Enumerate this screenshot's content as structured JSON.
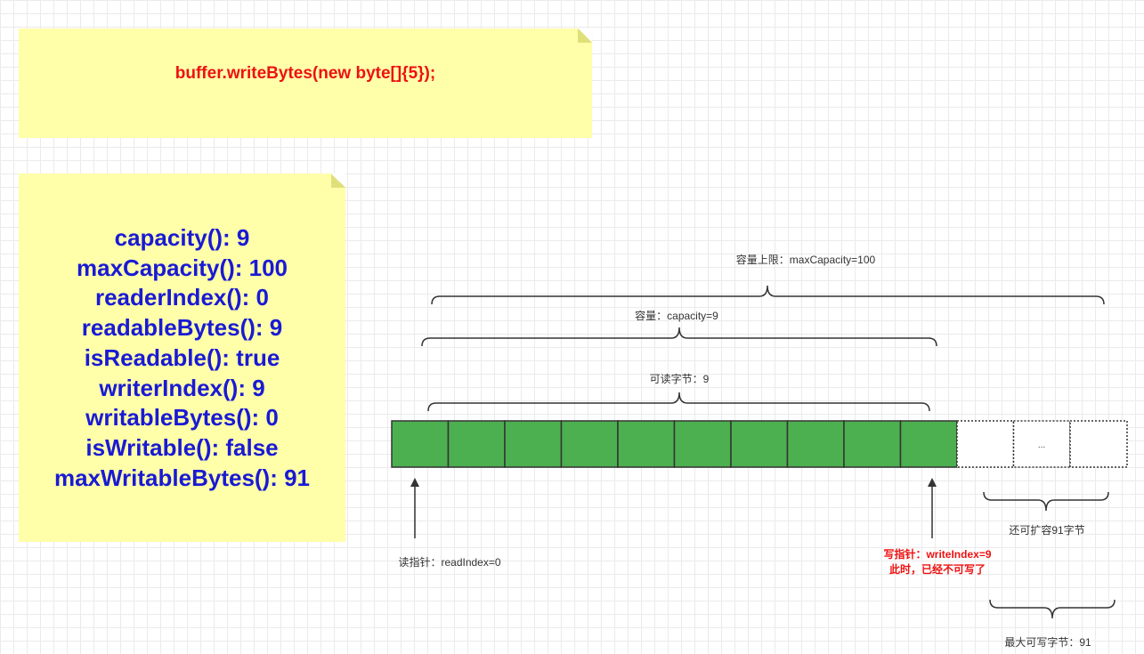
{
  "code_note": {
    "text": "buffer.writeBytes(new byte[]{5});"
  },
  "status_note": {
    "lines": [
      "capacity(): 9",
      "maxCapacity(): 100",
      "readerIndex(): 0",
      "readableBytes(): 9",
      "isReadable(): true",
      "writerIndex(): 9",
      "writableBytes(): 0",
      "isWritable(): false",
      "maxWritableBytes(): 91"
    ]
  },
  "diagram": {
    "brace_max_capacity": "容量上限：maxCapacity=100",
    "brace_capacity": "容量：capacity=9",
    "brace_readable": "可读字节：9",
    "filled_cells": 10,
    "empty_cells": 3,
    "ellipsis": "...",
    "brace_expandable": "还可扩容91字节",
    "read_pointer": "读指针：readIndex=0",
    "write_pointer_line1": "写指针：writeIndex=9",
    "write_pointer_line2": "此时，已经不可写了",
    "brace_max_writable": "最大可写字节：91",
    "colors": {
      "filled": "#4caf50",
      "accent_red": "#ee1111",
      "accent_blue": "#1a1ad4",
      "note_bg": "#ffffaa"
    }
  }
}
